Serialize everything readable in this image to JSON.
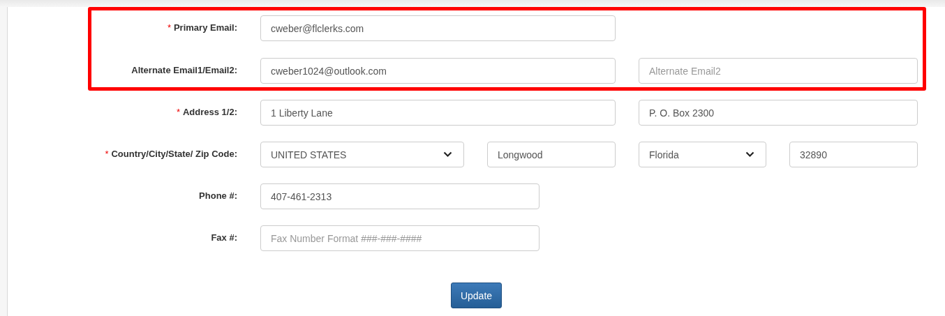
{
  "rows": [
    {
      "label": "Primary Email:",
      "required": true,
      "highlighted": true,
      "fields": [
        {
          "kind": "input",
          "value": "cweber@flclerks.com"
        }
      ]
    },
    {
      "label": "Alternate Email1/Email2:",
      "required": false,
      "highlighted": true,
      "fields": [
        {
          "kind": "input",
          "value": "cweber1024@outlook.com"
        },
        {
          "kind": "input",
          "placeholder": "Alternate Email2"
        }
      ]
    },
    {
      "label": "Address 1/2:",
      "required": true,
      "highlighted": false,
      "fields": [
        {
          "kind": "input",
          "value": "1 Liberty Lane"
        },
        {
          "kind": "input",
          "value": "P. O. Box 2300"
        }
      ]
    },
    {
      "label": "Country/City/State/ Zip Code:",
      "required": true,
      "highlighted": false,
      "fields": [
        {
          "kind": "select",
          "value": "UNITED STATES"
        },
        {
          "kind": "input",
          "value": "Longwood"
        },
        {
          "kind": "select",
          "value": "Florida"
        },
        {
          "kind": "input",
          "value": "32890"
        }
      ]
    },
    {
      "label": "Phone #:",
      "required": false,
      "highlighted": false,
      "fields": [
        {
          "kind": "input",
          "value": "407-461-2313"
        }
      ]
    },
    {
      "label": "Fax #:",
      "required": false,
      "highlighted": false,
      "fields": [
        {
          "kind": "input",
          "placeholder": "Fax Number Format ###-###-####"
        }
      ]
    }
  ],
  "required_mark": "*",
  "button": "Update"
}
